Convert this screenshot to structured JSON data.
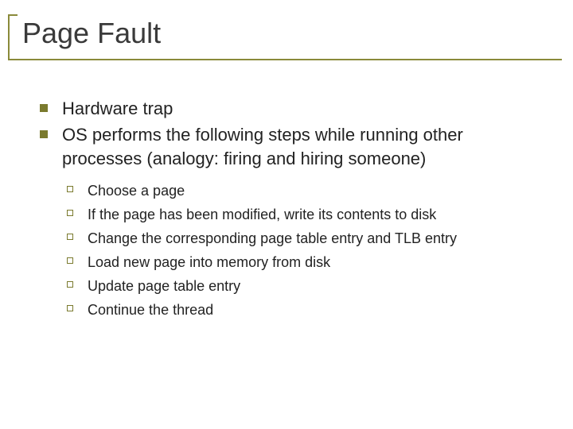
{
  "title": "Page Fault",
  "bullets": [
    {
      "text": "Hardware trap"
    },
    {
      "text": "OS performs the following steps while running other processes (analogy:  firing and hiring someone)",
      "sub": [
        "Choose a page",
        "If the page has been modified, write its contents to disk",
        "Change the corresponding page table entry and TLB entry",
        "Load new page into memory from disk",
        "Update page table entry",
        "Continue the thread"
      ]
    }
  ]
}
